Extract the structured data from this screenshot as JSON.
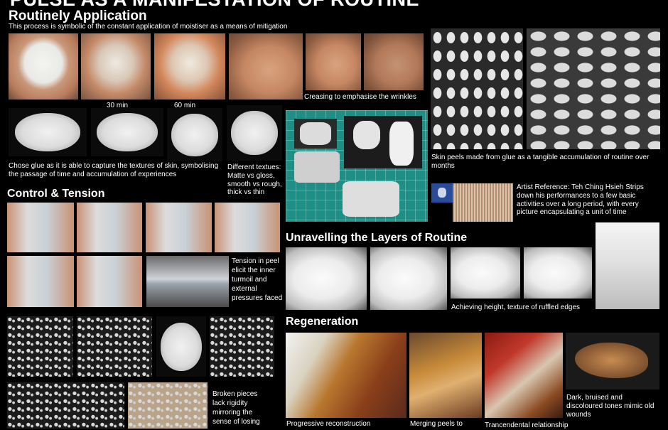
{
  "header": {
    "title": "PULSE AS A MANIFESTATION OF ROUTINE"
  },
  "sections": {
    "routine": {
      "title": "Routinely Application",
      "subtitle": "This process is symbolic of the constant application of moistiser as a means of mitigation",
      "label_30": "30 min",
      "label_60": "60 min",
      "crease_caption": "Creasing to emphasise the wrinkles",
      "glue_caption": "Chose glue as it is able to capture the textures of skin, symbolising the passage of time and accumulation of experiences",
      "textures_caption": "Different textues: Matte vs gloss, smooth vs rough, thick vs thin"
    },
    "peels": {
      "caption": "Skin peels made from glue as a tangible accumulation of routine over months",
      "artist_caption": "Artist Reference: Teh Ching Hsieh Strips down his performances to a few basic activities over a long period, with every picture encapsulating a unit of time"
    },
    "control": {
      "title": "Control & Tension",
      "tension_caption": "Tension in peel elicit the inner turmoil and external pressures faced",
      "broken_caption": "Broken pieces lack rigidity mirroring the sense of losing"
    },
    "layers": {
      "title": "Unravelling the Layers of Routine",
      "caption": "Achieving height, texture of ruffled edges"
    },
    "regen": {
      "title": "Regeneration",
      "caption_1": "Progressive reconstruction",
      "caption_2": "Merging peels to",
      "caption_3": "Trancendental relationship",
      "caption_4": "Dark, bruised and discoloured tones mimic old wounds"
    }
  }
}
